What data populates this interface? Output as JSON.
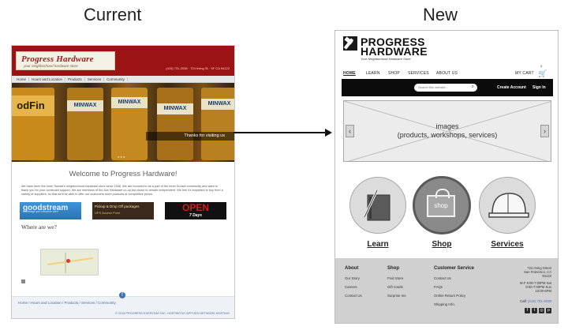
{
  "captions": {
    "current": "Current",
    "new": "New"
  },
  "old_site": {
    "logo_text": "Progress Hardware",
    "logo_tagline": "your neighborhood hardware store",
    "contact": "(415) 731-2038 · 724 Irving St · SF CA 94122",
    "nav": [
      "Home",
      "Hours and Location",
      "Products",
      "Services",
      "Community"
    ],
    "hero_cans": [
      "MINWAX",
      "MINWAX",
      "MINWAX",
      "MINWAX"
    ],
    "hero_left_text": "odFin",
    "hero_caption": "Thanks for visiting us",
    "welcome": "Welcome to Progress Hardware!",
    "body_text": "We have been the Inner Sunset's neighborhood hardware store since 1948. We are honored to be a part of the Inner Sunset community and want to thank you for your continued support. We are members of the Ace Hardware co-op but chose to remain independent. We feel it's important to buy from a variety of suppliers, so that we'll be able to offer our customers more products at competitive prices.",
    "ad_goodstream": "goodstream",
    "ad_goodstream_sub": "Exchange you romance card",
    "ad_ups": "Pickup & Drop Off packages",
    "ad_ups_sub": "UPS Access Point",
    "ad_open": "OPEN",
    "ad_open_sub": "7 Days",
    "where": "Where are we?",
    "footer_breadcrumb": "Home  /  Hours and Location  /  Products  /  Services  /  Community",
    "footer_copy": "© 2016 PROGRESS EVERYDAY INC. HOSTING BY APPLIED NETWORK HOSTING",
    "fb_icon": "f"
  },
  "new_site": {
    "brand_line1": "PROGRESS",
    "brand_line2": "HARDWARE",
    "tagline": "Your Neighborhood Hardware Store",
    "nav": {
      "home": "HOME",
      "learn": "LEARN",
      "shop": "SHOP",
      "services": "SERVICES",
      "about": "ABOUT US",
      "cart": "MY CART",
      "cart_count": "0"
    },
    "search_placeholder": "Search this website...",
    "create_account": "Create Account",
    "sign_in": "Sign In",
    "slider_line1": "images",
    "slider_line2": "(products, workshops, services)",
    "features": {
      "learn": "Learn",
      "shop": "Shop",
      "shop_bag": "shop",
      "services": "Services"
    },
    "footer": {
      "about_title": "About",
      "about_items": [
        "Our Story",
        "Careers",
        "Contact Us"
      ],
      "shop_title": "Shop",
      "shop_items": [
        "Find Store",
        "Gift Cards",
        "Surprise me"
      ],
      "cs_title": "Customer Service",
      "cs_items": [
        "Contact Us",
        "FAQs",
        "Online Return Policy",
        "Shipping Info."
      ],
      "address_1": "724 Irving Street",
      "address_2": "San Francisco, CA",
      "address_3": "94122",
      "hours_1": "M-F 8:00-7:00PM   Sat",
      "hours_2": "9:00-7:00PM   Sun",
      "hours_3": "10:00-6PM",
      "phone_label": "Call: ",
      "phone": "(415) 731-2038"
    }
  }
}
